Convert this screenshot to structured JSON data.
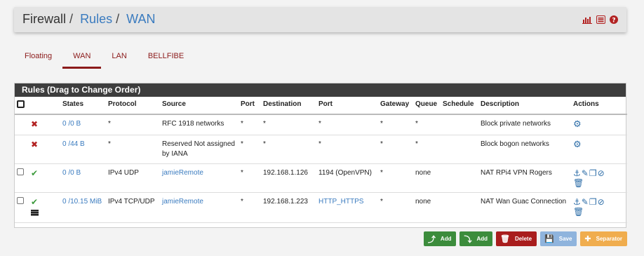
{
  "breadcrumb": {
    "root": "Firewall",
    "rules": "Rules",
    "current": "WAN",
    "separator": "/"
  },
  "header_icons": [
    "bar-chart-icon",
    "list-icon",
    "help-icon"
  ],
  "colors": {
    "accent_red": "#8b1a1a",
    "link_blue": "#3a7bbf",
    "panel_header": "#3d3d3d",
    "green_button": "#3c8c3c",
    "red_button": "#a91d1d",
    "save_button": "#8fb4dd",
    "separator_button": "#f0ad4e"
  },
  "tabs": [
    {
      "label": "Floating",
      "active": false
    },
    {
      "label": "WAN",
      "active": true
    },
    {
      "label": "LAN",
      "active": false
    },
    {
      "label": "BELLFIBE",
      "active": false
    }
  ],
  "panel": {
    "title": "Rules (Drag to Change Order)"
  },
  "table": {
    "headers": {
      "states": "States",
      "protocol": "Protocol",
      "source": "Source",
      "port": "Port",
      "destination": "Destination",
      "dport": "Port",
      "gateway": "Gateway",
      "queue": "Queue",
      "schedule": "Schedule",
      "description": "Description",
      "actions": "Actions"
    },
    "rows": [
      {
        "status": "block",
        "states": "0 /0 B",
        "protocol": "*",
        "source": "RFC 1918 networks",
        "port": "*",
        "destination": "*",
        "dport": "*",
        "gateway": "*",
        "queue": "*",
        "schedule": "",
        "description": "Block private networks"
      },
      {
        "status": "block",
        "states": "0 /44 B",
        "protocol": "*",
        "source": "Reserved Not assigned by IANA",
        "port": "*",
        "destination": "*",
        "dport": "*",
        "gateway": "*",
        "queue": "*",
        "schedule": "",
        "description": "Block bogon networks"
      },
      {
        "status": "pass",
        "states": "0 /0 B",
        "protocol": "IPv4 UDP",
        "source": "jamieRemote",
        "port": "*",
        "destination": "192.168.1.126",
        "dport": "1194 (OpenVPN)",
        "gateway": "*",
        "queue": "none",
        "schedule": "",
        "description": "NAT RPi4 VPN Rogers"
      },
      {
        "status": "pass",
        "states": "0 /10.15 MiB",
        "protocol": "IPv4 TCP/UDP",
        "source": "jamieRemote",
        "port": "*",
        "destination": "192.168.1.223",
        "dport": "HTTP_HTTPS",
        "gateway": "*",
        "queue": "none",
        "schedule": "",
        "description": "NAT Wan Guac Connection"
      }
    ]
  },
  "buttons": {
    "add_top": "Add",
    "add_bottom": "Add",
    "delete": "Delete",
    "save": "Save",
    "separator": "Separator"
  }
}
